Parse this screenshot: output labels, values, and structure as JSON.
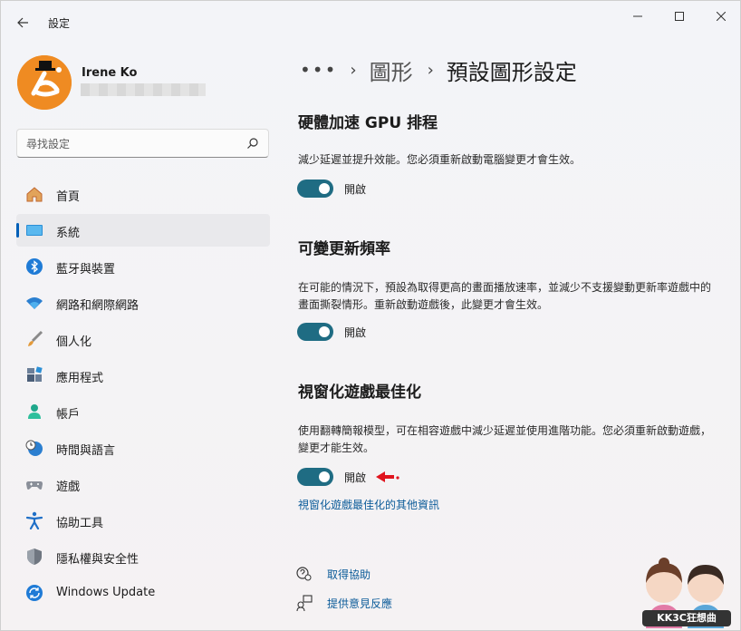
{
  "window": {
    "app_title": "設定"
  },
  "profile": {
    "name": "Irene Ko"
  },
  "search": {
    "placeholder": "尋找設定"
  },
  "sidebar": {
    "items": [
      {
        "label": "首頁",
        "icon": "home-icon"
      },
      {
        "label": "系統",
        "icon": "system-icon",
        "selected": true
      },
      {
        "label": "藍牙與裝置",
        "icon": "bluetooth-icon"
      },
      {
        "label": "網路和網際網路",
        "icon": "wifi-icon"
      },
      {
        "label": "個人化",
        "icon": "brush-icon"
      },
      {
        "label": "應用程式",
        "icon": "apps-icon"
      },
      {
        "label": "帳戶",
        "icon": "account-icon"
      },
      {
        "label": "時間與語言",
        "icon": "clock-globe-icon"
      },
      {
        "label": "遊戲",
        "icon": "gamepad-icon"
      },
      {
        "label": "協助工具",
        "icon": "accessibility-icon"
      },
      {
        "label": "隱私權與安全性",
        "icon": "shield-icon"
      },
      {
        "label": "Windows Update",
        "icon": "windows-update-icon"
      }
    ]
  },
  "breadcrumb": {
    "more": "•••",
    "parent": "圖形",
    "current": "預設圖形設定"
  },
  "sections": [
    {
      "title": "硬體加速 GPU 排程",
      "desc": "減少延遲並提升效能。您必須重新啟動電腦變更才會生效。",
      "toggle_label": "開啟"
    },
    {
      "title": "可變更新頻率",
      "desc": "在可能的情況下，預設為取得更高的畫面播放速率，並減少不支援變動更新率遊戲中的畫面撕裂情形。重新啟動遊戲後，此變更才會生效。",
      "toggle_label": "開啟"
    },
    {
      "title": "視窗化遊戲最佳化",
      "desc": "使用翻轉簡報模型，可在相容遊戲中減少延遲並使用進階功能。您必須重新啟動遊戲，變更才能生效。",
      "toggle_label": "開啟",
      "link": "視窗化遊戲最佳化的其他資訊"
    }
  ],
  "footer": {
    "help": "取得協助",
    "feedback": "提供意見反應"
  },
  "watermark": {
    "text": "KK3C狂想曲"
  },
  "colors": {
    "accent": "#005fb8",
    "toggle_on": "#1f6c83",
    "link": "#0b5b99",
    "arrow": "#e0141e"
  }
}
